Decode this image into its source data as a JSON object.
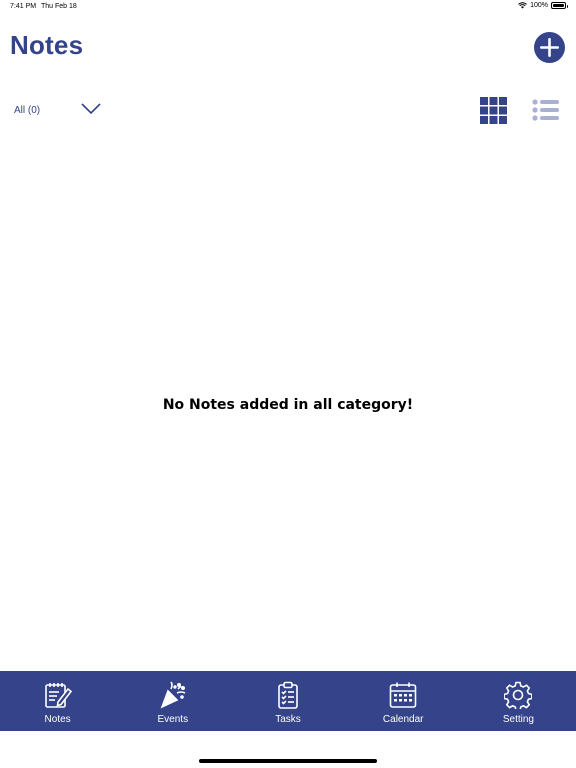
{
  "status_bar": {
    "time": "7:41 PM",
    "date": "Thu Feb 18",
    "battery": "100%",
    "wifi_icon": "wifi-icon",
    "battery_icon": "battery-icon"
  },
  "header": {
    "title": "Notes",
    "add_icon": "plus-icon"
  },
  "filter": {
    "category_label": "All (0)",
    "dropdown_icon": "chevron-down-icon",
    "view_modes": [
      "grid-view-icon",
      "list-view-icon"
    ],
    "active_view": "grid"
  },
  "main": {
    "empty_message": "No Notes added in all category!"
  },
  "tab_bar": {
    "tabs": [
      {
        "label": "Notes",
        "icon": "notes-icon"
      },
      {
        "label": "Events",
        "icon": "party-popper-icon"
      },
      {
        "label": "Tasks",
        "icon": "clipboard-checklist-icon"
      },
      {
        "label": "Calendar",
        "icon": "calendar-icon"
      },
      {
        "label": "Setting",
        "icon": "gear-icon"
      }
    ]
  },
  "colors": {
    "primary": "#34438a",
    "inactive_icon": "#a9b0d2",
    "text_dark": "#000000",
    "background": "#ffffff"
  }
}
